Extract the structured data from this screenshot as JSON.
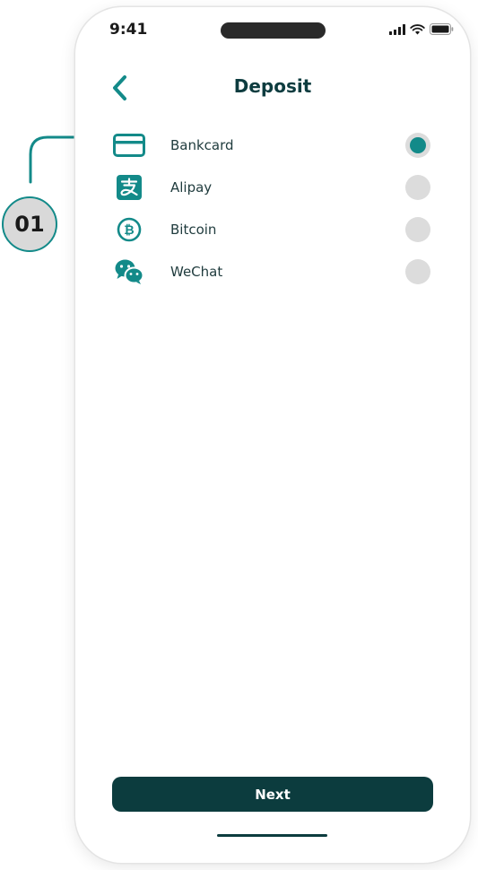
{
  "status_bar": {
    "time": "9:41"
  },
  "header": {
    "title": "Deposit",
    "back_icon": "chevron-left-icon"
  },
  "payment_methods": [
    {
      "label": "Bankcard",
      "icon": "credit-card-icon",
      "selected": true
    },
    {
      "label": "Alipay",
      "icon": "alipay-icon",
      "selected": false
    },
    {
      "label": "Bitcoin",
      "icon": "bitcoin-icon",
      "selected": false
    },
    {
      "label": "WeChat",
      "icon": "wechat-icon",
      "selected": false
    }
  ],
  "actions": {
    "next_label": "Next"
  },
  "annotation": {
    "badge_text": "01"
  },
  "colors": {
    "accent": "#138a89",
    "primary_dark": "#0c3c3e",
    "radio_unselected": "#dcdcdc"
  }
}
